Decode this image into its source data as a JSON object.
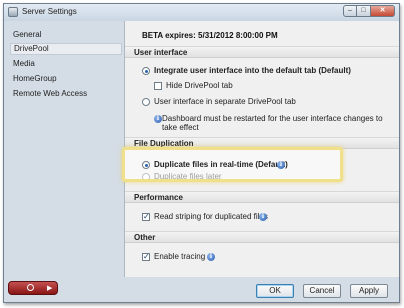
{
  "window": {
    "title": "Server Settings"
  },
  "sidebar": {
    "items": [
      {
        "label": "General"
      },
      {
        "label": "DrivePool",
        "selected": true
      },
      {
        "label": "Media"
      },
      {
        "label": "HomeGroup"
      },
      {
        "label": "Remote Web Access"
      }
    ]
  },
  "content": {
    "beta_text": "BETA expires: 5/31/2012 8:00:00 PM",
    "sections": {
      "user_interface": "User interface",
      "file_duplication": "File Duplication",
      "performance": "Performance",
      "other": "Other"
    },
    "options": {
      "integrate_ui": "Integrate user interface into the default tab (Default)",
      "hide_tab": "Hide DrivePool tab",
      "separate_tab": "User interface in separate DrivePool tab",
      "restart_note": "Dashboard must be restarted for the user interface changes to take effect",
      "dup_realtime": "Duplicate files in real-time (Default)",
      "dup_later": "Duplicate files later",
      "read_striping": "Read striping for duplicated files",
      "enable_tracing": "Enable tracing"
    }
  },
  "buttons": {
    "ok": "OK",
    "cancel": "Cancel",
    "apply": "Apply"
  },
  "colors": {
    "highlight": "#f0e08a",
    "power_button": "#a22222",
    "selected_item_bg": "#e9edf1"
  }
}
